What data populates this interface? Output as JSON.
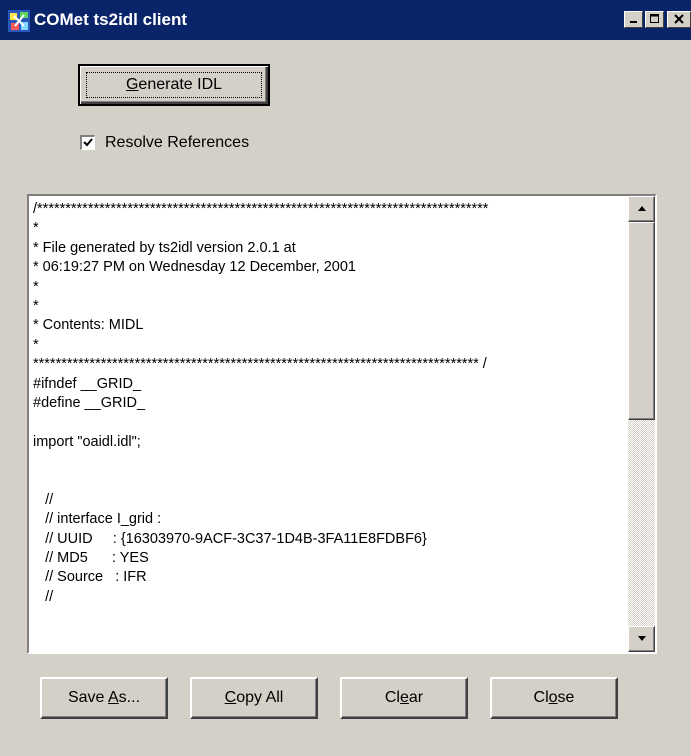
{
  "window": {
    "title": "COMet ts2idl client",
    "icon": "app-icon",
    "controls": {
      "minimize": "minimize-icon",
      "maximize": "maximize-icon",
      "close": "close-icon"
    },
    "titlebar_color": "#0a246a"
  },
  "toolbar": {
    "generate_label_pre": "",
    "generate_label_ul": "G",
    "generate_label_post": "enerate IDL"
  },
  "options": {
    "resolve_references_label": "Resolve References",
    "resolve_references_checked": true
  },
  "output": {
    "lines": [
      "/********************************************************************************",
      "*",
      "* File generated by ts2idl version 2.0.1 at",
      "* 06:19:27 PM on Wednesday 12 December, 2001",
      "*",
      "*",
      "* Contents: MIDL",
      "*",
      "******************************************************************************* /",
      "#ifndef __GRID_",
      "#define __GRID_",
      "",
      "import \"oaidl.idl\";",
      "",
      "",
      "   //",
      "   // interface I_grid :",
      "   // UUID     : {16303970-9ACF-3C37-1D4B-3FA11E8FDBF6}",
      "   // MD5      : YES",
      "   // Source   : IFR",
      "   //",
      ""
    ]
  },
  "buttons": {
    "save_as": {
      "pre": "Save ",
      "ul": "A",
      "post": "s..."
    },
    "copy_all": {
      "pre": "",
      "ul": "C",
      "post": "opy All"
    },
    "clear": {
      "pre": "Cl",
      "ul": "e",
      "post": "ar"
    },
    "close": {
      "pre": "Cl",
      "ul": "o",
      "post": "se"
    }
  }
}
